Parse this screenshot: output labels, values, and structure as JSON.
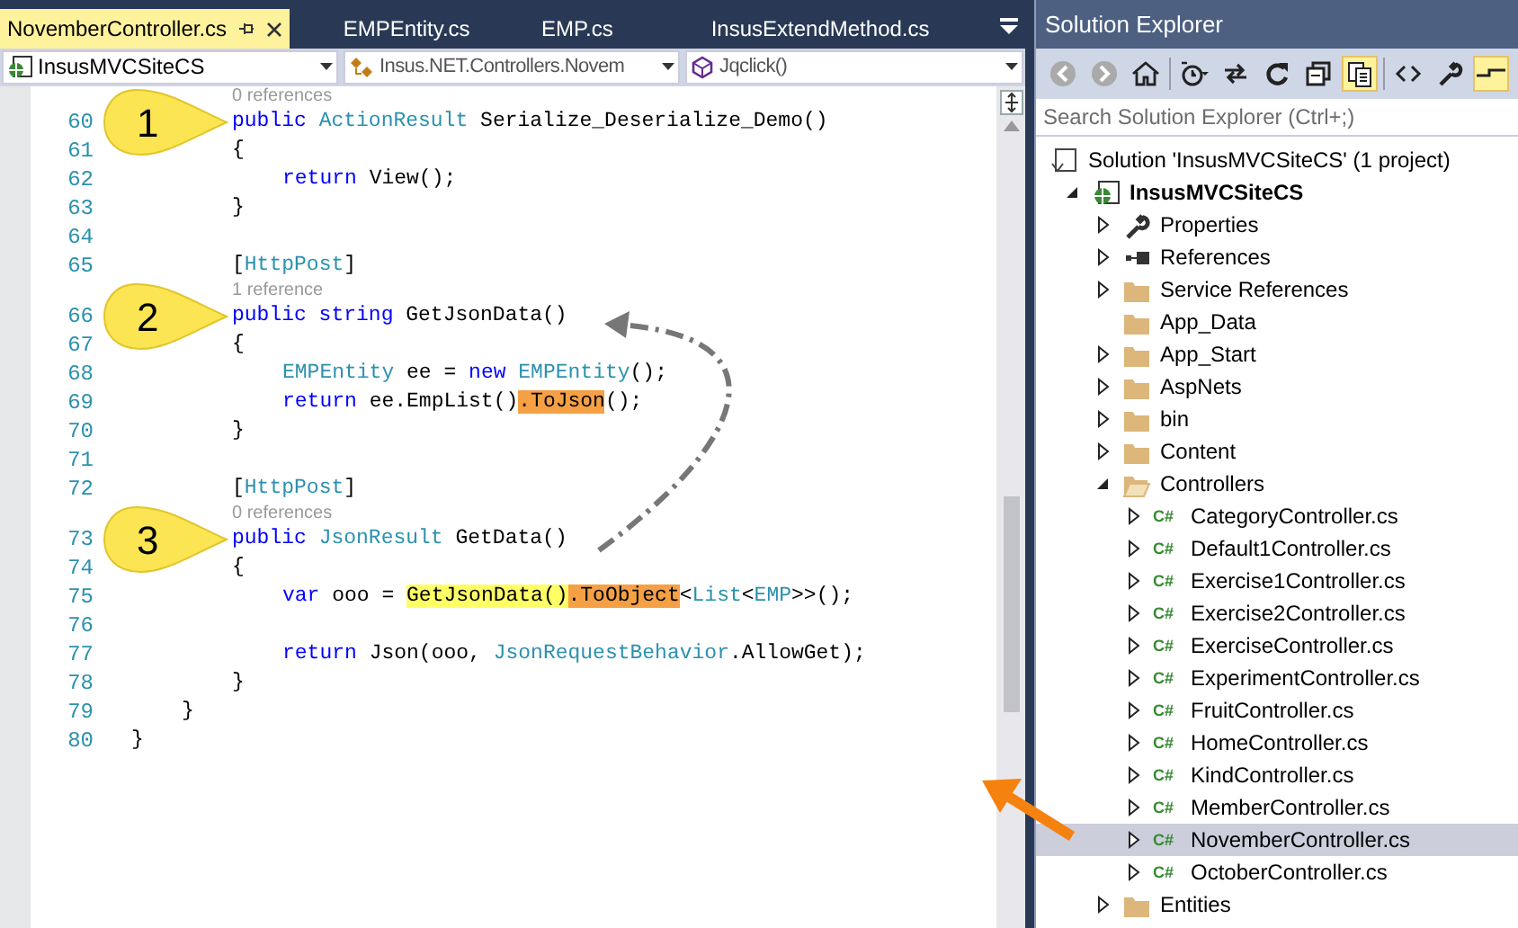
{
  "tabs": [
    {
      "label": "NovemberController.cs",
      "selected": true
    },
    {
      "label": "EMPEntity.cs",
      "selected": false
    },
    {
      "label": "EMP.cs",
      "selected": false
    },
    {
      "label": "InsusExtendMethod.cs",
      "selected": false
    }
  ],
  "navigation_bar": {
    "project": "InsusMVCSiteCS",
    "type": "Insus.NET.Controllers.Novem",
    "member": "Jqclick()"
  },
  "code_lines": [
    {
      "number": "60",
      "kind": "member",
      "lens": "0 references",
      "callout": "1",
      "tokens": [
        {
          "text": "public ",
          "kind": "keyword"
        },
        {
          "text": "ActionResult",
          "kind": "type"
        },
        {
          "text": " Serialize_Deserialize_Demo()",
          "kind": "plain"
        }
      ]
    },
    {
      "number": "61",
      "kind": "member",
      "tokens": [
        {
          "text": "{",
          "kind": "plain"
        }
      ]
    },
    {
      "number": "62",
      "kind": "body",
      "tokens": [
        {
          "text": "return",
          "kind": "keyword"
        },
        {
          "text": " View();",
          "kind": "plain"
        }
      ]
    },
    {
      "number": "63",
      "kind": "member",
      "tokens": [
        {
          "text": "}",
          "kind": "plain"
        }
      ]
    },
    {
      "number": "64",
      "kind": "member"
    },
    {
      "number": "65",
      "kind": "member",
      "tokens": [
        {
          "text": "[",
          "kind": "plain"
        },
        {
          "text": "HttpPost",
          "kind": "type"
        },
        {
          "text": "]",
          "kind": "plain"
        }
      ]
    },
    {
      "number": "66",
      "kind": "member",
      "lens": "1 reference",
      "callout": "2",
      "tokens": [
        {
          "text": "public string",
          "kind": "keyword"
        },
        {
          "text": " GetJsonData()",
          "kind": "plain"
        }
      ]
    },
    {
      "number": "67",
      "kind": "member",
      "tokens": [
        {
          "text": "{",
          "kind": "plain"
        }
      ]
    },
    {
      "number": "68",
      "kind": "body",
      "tokens": [
        {
          "text": "EMPEntity",
          "kind": "type"
        },
        {
          "text": " ee = ",
          "kind": "plain"
        },
        {
          "text": "new ",
          "kind": "keyword"
        },
        {
          "text": "EMPEntity",
          "kind": "type"
        },
        {
          "text": "();",
          "kind": "plain"
        }
      ]
    },
    {
      "number": "69",
      "kind": "body",
      "tokens": [
        {
          "text": "return",
          "kind": "keyword"
        },
        {
          "text": " ee.EmpList()",
          "kind": "plain"
        },
        {
          "text": ".ToJson",
          "kind": "orange-mark"
        },
        {
          "text": "();",
          "kind": "plain"
        }
      ]
    },
    {
      "number": "70",
      "kind": "member",
      "tokens": [
        {
          "text": "}",
          "kind": "plain"
        }
      ]
    },
    {
      "number": "71",
      "kind": "member"
    },
    {
      "number": "72",
      "kind": "member",
      "tokens": [
        {
          "text": "[",
          "kind": "plain"
        },
        {
          "text": "HttpPost",
          "kind": "type"
        },
        {
          "text": "]",
          "kind": "plain"
        }
      ]
    },
    {
      "number": "73",
      "kind": "member",
      "lens": "0 references",
      "callout": "3",
      "tokens": [
        {
          "text": "public ",
          "kind": "keyword"
        },
        {
          "text": "JsonResult",
          "kind": "type"
        },
        {
          "text": " GetData()",
          "kind": "plain"
        }
      ]
    },
    {
      "number": "74",
      "kind": "member",
      "tokens": [
        {
          "text": "{",
          "kind": "plain"
        }
      ]
    },
    {
      "number": "75",
      "kind": "body",
      "tokens": [
        {
          "text": "var",
          "kind": "keyword"
        },
        {
          "text": " ooo = ",
          "kind": "plain"
        },
        {
          "text": "GetJsonData()",
          "kind": "yellow-mark"
        },
        {
          "text": ".ToObject",
          "kind": "orange-mark"
        },
        {
          "text": "<",
          "kind": "plain"
        },
        {
          "text": "List",
          "kind": "type"
        },
        {
          "text": "<",
          "kind": "plain"
        },
        {
          "text": "EMP",
          "kind": "type"
        },
        {
          "text": ">>();",
          "kind": "plain"
        }
      ]
    },
    {
      "number": "76",
      "kind": "member"
    },
    {
      "number": "77",
      "kind": "body",
      "tokens": [
        {
          "text": "return",
          "kind": "keyword"
        },
        {
          "text": " Json(ooo, ",
          "kind": "plain"
        },
        {
          "text": "JsonRequestBehavior",
          "kind": "type"
        },
        {
          "text": ".AllowGet);",
          "kind": "plain"
        }
      ]
    },
    {
      "number": "78",
      "kind": "member",
      "tokens": [
        {
          "text": "}",
          "kind": "plain"
        }
      ]
    },
    {
      "number": "79",
      "kind": "class",
      "tokens": [
        {
          "text": "}",
          "kind": "plain"
        }
      ]
    },
    {
      "number": "80",
      "kind": "namespace",
      "tokens": [
        {
          "text": "}",
          "kind": "plain"
        }
      ]
    }
  ],
  "solution_explorer": {
    "title": "Solution Explorer",
    "toolbar": [
      {
        "kind": "back",
        "on": false
      },
      {
        "kind": "forward",
        "on": false
      },
      {
        "kind": "home",
        "on": false
      },
      {
        "kind": "history",
        "on": false
      },
      {
        "kind": "sync",
        "on": false
      },
      {
        "kind": "refresh",
        "on": false
      },
      {
        "kind": "collapse",
        "on": false
      },
      {
        "kind": "show-all",
        "on": true
      },
      {
        "kind": "code",
        "on": false
      },
      {
        "kind": "properties",
        "on": false
      },
      {
        "kind": "preview",
        "on": true
      }
    ],
    "search": {
      "placeholder": "Search Solution Explorer (Ctrl+;)"
    },
    "tree": [
      {
        "label": "Solution 'InsusMVCSiteCS' (1 project)",
        "kind": "solution",
        "selected": false,
        "children": [
          {
            "label": "InsusMVCSiteCS",
            "kind": "project",
            "bold": true,
            "expanded": true,
            "selected": false,
            "children": [
              {
                "label": "Properties",
                "kind": "wrench",
                "expanded": false,
                "selected": false
              },
              {
                "label": "References",
                "kind": "references",
                "expanded": false,
                "selected": false
              },
              {
                "label": "Service References",
                "kind": "folder",
                "expanded": false,
                "selected": false
              },
              {
                "label": "App_Data",
                "kind": "folder",
                "selected": false
              },
              {
                "label": "App_Start",
                "kind": "folder",
                "expanded": false,
                "selected": false
              },
              {
                "label": "AspNets",
                "kind": "folder",
                "expanded": false,
                "selected": false
              },
              {
                "label": "bin",
                "kind": "folder",
                "expanded": false,
                "selected": false
              },
              {
                "label": "Content",
                "kind": "folder",
                "expanded": false,
                "selected": false
              },
              {
                "label": "Controllers",
                "kind": "folder",
                "expanded": true,
                "selected": false,
                "children": [
                  {
                    "label": "CategoryController.cs",
                    "kind": "csharp",
                    "badge": "C#",
                    "expanded": false,
                    "selected": false
                  },
                  {
                    "label": "Default1Controller.cs",
                    "kind": "csharp",
                    "badge": "C#",
                    "expanded": false,
                    "selected": false
                  },
                  {
                    "label": "Exercise1Controller.cs",
                    "kind": "csharp",
                    "badge": "C#",
                    "expanded": false,
                    "selected": false
                  },
                  {
                    "label": "Exercise2Controller.cs",
                    "kind": "csharp",
                    "badge": "C#",
                    "expanded": false,
                    "selected": false
                  },
                  {
                    "label": "ExerciseController.cs",
                    "kind": "csharp",
                    "badge": "C#",
                    "expanded": false,
                    "selected": false
                  },
                  {
                    "label": "ExperimentController.cs",
                    "kind": "csharp",
                    "badge": "C#",
                    "expanded": false,
                    "selected": false
                  },
                  {
                    "label": "FruitController.cs",
                    "kind": "csharp",
                    "badge": "C#",
                    "expanded": false,
                    "selected": false
                  },
                  {
                    "label": "HomeController.cs",
                    "kind": "csharp",
                    "badge": "C#",
                    "expanded": false,
                    "selected": false
                  },
                  {
                    "label": "KindController.cs",
                    "kind": "csharp",
                    "badge": "C#",
                    "expanded": false,
                    "selected": false
                  },
                  {
                    "label": "MemberController.cs",
                    "kind": "csharp",
                    "badge": "C#",
                    "expanded": false,
                    "selected": false
                  },
                  {
                    "label": "NovemberController.cs",
                    "kind": "csharp",
                    "badge": "C#",
                    "expanded": false,
                    "selected": true
                  },
                  {
                    "label": "OctoberController.cs",
                    "kind": "csharp",
                    "badge": "C#",
                    "expanded": false,
                    "selected": false
                  }
                ]
              },
              {
                "label": "Entities",
                "kind": "folder",
                "expanded": false,
                "selected": false
              }
            ]
          }
        ]
      }
    ]
  }
}
